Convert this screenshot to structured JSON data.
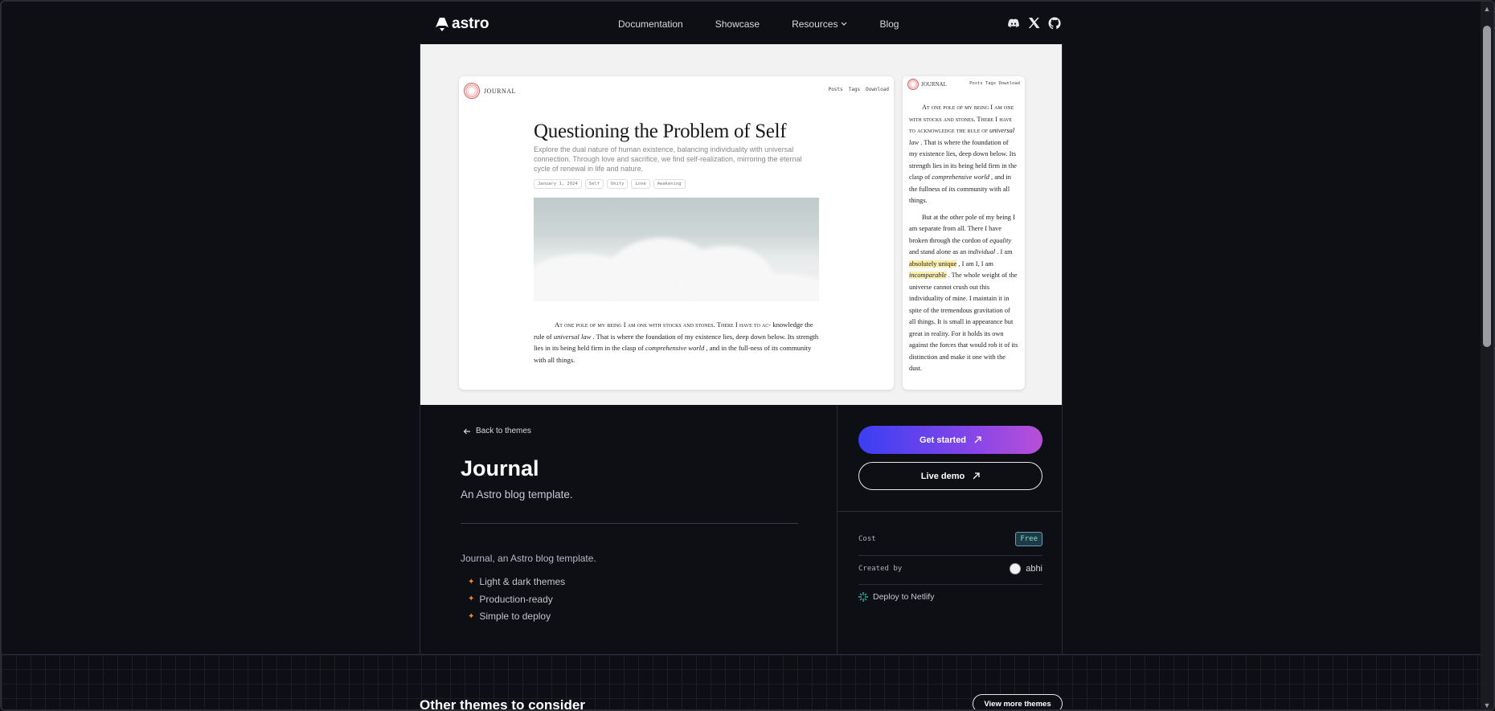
{
  "nav": {
    "brand": "astro",
    "links": [
      {
        "label": "Documentation"
      },
      {
        "label": "Showcase"
      },
      {
        "label": "Resources"
      },
      {
        "label": "Blog"
      }
    ],
    "socials": [
      "discord-icon",
      "x-icon",
      "github-icon"
    ]
  },
  "preview": {
    "brand": "JOURNAL",
    "links": [
      "Posts",
      "Tags",
      "Download"
    ],
    "side_links": "Posts Tags Download",
    "title": "Questioning the Problem of Self",
    "description": "Explore the dual nature of human existence, balancing individuality with universal connection. Through love and sacrifice, we find self-realization, mirroring the eternal cycle of renewal in life and nature.",
    "tags": [
      "January 1, 2024",
      "Self",
      "Unity",
      "Love",
      "Awakening"
    ],
    "body": {
      "lead": "At one pole of my being I am one with stocks and stones. There I have to ac-",
      "p1": "knowledge the rule of ",
      "em1": "universal law",
      "p2": " . That is where the foundation of my existence lies, deep down below. Its strength lies in its being held firm in the clasp of ",
      "em2": "comprehensive world",
      "p3": " , and in the full-ness of its community with all things."
    },
    "side": {
      "a1": "At one pole of my being I am one with stocks and stones. There I have to acknowledge the rule of ",
      "a1em": "universal law",
      "a2": " . That is where the foundation of my existence lies, deep down below. Its strength lies in its being held firm in the clasp of ",
      "a2em": "comprehensive world",
      "a3": " , and in the fullness of its community with all things.",
      "b1": "But at the other pole of my being I am separate from all. There I have broken through the cordon of ",
      "b1em": "equality",
      "b2": " and stand alone as an ",
      "b2em": "individual",
      "b3": " . I am ",
      "b3hl": "absolutely unique",
      "b4": " , I am I, I am ",
      "b4hl": "incomparable",
      "b5": " . The whole weight of the universe cannot crush out this individuality of mine. I maintain it in spite of the tremendous gravitation of all things. It is small in appearance but great in reality. For it holds its own against the forces that would rob it of its distinction and make it one with the dust."
    }
  },
  "details": {
    "back_label": "Back to themes",
    "title": "Journal",
    "subtitle": "An Astro blog template.",
    "description": "Journal, an Astro blog template.",
    "features": [
      "Light & dark themes",
      "Production-ready",
      "Simple to deploy"
    ]
  },
  "actions": {
    "get_started": "Get started",
    "live_demo": "Live demo"
  },
  "meta": {
    "cost_label": "Cost",
    "cost_value": "Free",
    "created_by_label": "Created by",
    "creator": "abhi",
    "deploy_label": "Deploy to Netlify"
  },
  "bottom": {
    "title": "Other themes to consider",
    "view_more": "View more themes"
  },
  "colors": {
    "background": "#0d0f14",
    "primary_gradient_start": "#3b3ff2",
    "primary_gradient_end": "#b84fd8",
    "feature_star": "#f28c28",
    "free_badge": "#7fe0c4"
  }
}
